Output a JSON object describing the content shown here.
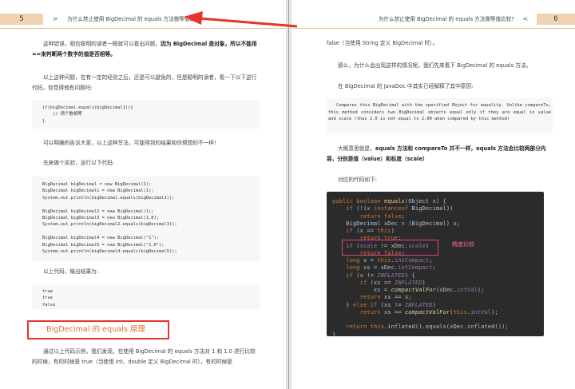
{
  "left_page": {
    "page_number": "5",
    "header_arrow": ">",
    "header_title": "为什么禁止使用 BigDecimal 的 equals 方法做等值比较?",
    "para1_pre": "这种错误，相信聪明的读者一眼就可以看出问题，",
    "para1_bold": "因为 BigDecimal 是对象，所以不能用==来判断两个数字的值是否相等。",
    "para2": "以上这种问题，在有一定的经验之后，还是可以避免的，但是聪明的读者，看一下以下这行代码，你觉得他有问题吗:",
    "code1": "if(bigDecimal.equals(bigDecimal1)){\n    // 两个数相等\n}",
    "para3": "可以明确的告诉大家，以上这种写法，可能得到的结果和你预想的不一样!",
    "para4": "先来做个实验，运行以下代码:",
    "code2": "BigDecimal bigDecimal = new BigDecimal(1);\nBigDecimal bigDecimal1 = new BigDecimal(1);\nSystem.out.println(bigDecimal.equals(bigDecimal1));\n\nBigDecimal bigDecimal2 = new BigDecimal(1);\nBigDecimal bigDecimal3 = new BigDecimal(1.0);\nSystem.out.println(bigDecimal2.equals(bigDecimal3));\n\nBigDecimal bigDecimal4 = new BigDecimal(\"1\");\nBigDecimal bigDecimal5 = new BigDecimal(\"1.0\");\nSystem.out.println(bigDecimal4.equals(bigDecimal5));",
    "para5": "以上代码，输出结果为:",
    "code3": "true\ntrue\nfalse",
    "section_heading": "BigDecimal 的 equals 原理",
    "para6": "通过以上代码示例，我们发现，在使用 BigDecimal 的 equals 方法对 1 和 1.0 进行比较的时候，有的时候是 true（当使用 int、double 定义 BigDecimal 时），有的时候是"
  },
  "right_page": {
    "header_title": "为什么禁止使用 BigDecimal 的 equals 方法做等值比较?",
    "header_arrow": "<",
    "page_number": "6",
    "para1": "false（当使用 String 定义 BigDecimal 时）。",
    "para2": "那么，为什么会出现这样的情况呢，我们先来看下 BigDecimal 的 equals 方法。",
    "para3": "在 BigDecimal 的 JavaDoc 中其实已经解释了其中原因:",
    "javadoc": "Compares this  BigDecimal with the specified Object for equality.  Unlike compareTo, this method considers two BigDecimal objects equal only if they are equal in value and scale (thus 2.0 is not equal to 2.00 when compared by this method)",
    "para4_pre": "大概意思就是，",
    "para4_bold": "equals 方法和 compareTo 并不一样，equals 方法会比较两部分内容，分别是值（value）和标度（scale）",
    "para5": "对应的代码如下:",
    "annotation": "精度比较",
    "code_lines": [
      [
        [
          "kw",
          "public boolean "
        ],
        [
          "fn",
          "equals"
        ],
        [
          "p",
          "(Object x) {"
        ]
      ],
      [
        [
          "p",
          "    "
        ],
        [
          "kw",
          "if "
        ],
        [
          "p",
          "(!(x "
        ],
        [
          "kw",
          "instanceof "
        ],
        [
          "p",
          "BigDecimal))"
        ]
      ],
      [
        [
          "p",
          "        "
        ],
        [
          "kw",
          "return false"
        ],
        [
          "p",
          ";"
        ]
      ],
      [
        [
          "p",
          "    BigDecimal xDec = (BigDecimal) x;"
        ]
      ],
      [
        [
          "p",
          "    "
        ],
        [
          "kw",
          "if "
        ],
        [
          "p",
          "(x == "
        ],
        [
          "kw",
          "this"
        ],
        [
          "p",
          ")"
        ]
      ],
      [
        [
          "p",
          "        "
        ],
        [
          "kw",
          "return true"
        ],
        [
          "p",
          ";"
        ]
      ],
      [
        [
          "p",
          "    "
        ],
        [
          "kw",
          "if "
        ],
        [
          "p",
          "("
        ],
        [
          "fd",
          "scale"
        ],
        [
          "p",
          " != xDec."
        ],
        [
          "fd",
          "scale"
        ],
        [
          "p",
          ")"
        ]
      ],
      [
        [
          "p",
          "        "
        ],
        [
          "kw",
          "return false"
        ],
        [
          "p",
          ";"
        ]
      ],
      [
        [
          "p",
          "    "
        ],
        [
          "kw",
          "long "
        ],
        [
          "p",
          "s = "
        ],
        [
          "kw",
          "this"
        ],
        [
          "p",
          "."
        ],
        [
          "fd",
          "intCompact"
        ],
        [
          "p",
          ";"
        ]
      ],
      [
        [
          "p",
          "    "
        ],
        [
          "kw",
          "long "
        ],
        [
          "p",
          "xs = xDec."
        ],
        [
          "fd",
          "intCompact"
        ],
        [
          "p",
          ";"
        ]
      ],
      [
        [
          "p",
          "    "
        ],
        [
          "kw",
          "if "
        ],
        [
          "p",
          "(s != "
        ],
        [
          "it",
          "INFLATED"
        ],
        [
          "p",
          ") {"
        ]
      ],
      [
        [
          "p",
          "        "
        ],
        [
          "kw",
          "if "
        ],
        [
          "p",
          "(xs == "
        ],
        [
          "it",
          "INFLATED"
        ],
        [
          "p",
          ")"
        ]
      ],
      [
        [
          "p",
          "            xs = "
        ],
        [
          "st",
          "compactValFor"
        ],
        [
          "p",
          "(xDec."
        ],
        [
          "fd",
          "intVal"
        ],
        [
          "p",
          ");"
        ]
      ],
      [
        [
          "p",
          "        "
        ],
        [
          "kw",
          "return "
        ],
        [
          "p",
          "xs == s;"
        ]
      ],
      [
        [
          "p",
          "    } "
        ],
        [
          "kw",
          "else if "
        ],
        [
          "p",
          "(xs != "
        ],
        [
          "it",
          "INFLATED"
        ],
        [
          "p",
          ")"
        ]
      ],
      [
        [
          "p",
          "        "
        ],
        [
          "kw",
          "return "
        ],
        [
          "p",
          "xs == "
        ],
        [
          "st",
          "compactValFor"
        ],
        [
          "p",
          "("
        ],
        [
          "kw",
          "this"
        ],
        [
          "p",
          "."
        ],
        [
          "fd",
          "intVal"
        ],
        [
          "p",
          ");"
        ]
      ],
      [
        [
          "p",
          ""
        ]
      ],
      [
        [
          "p",
          "    "
        ],
        [
          "kw",
          "return this"
        ],
        [
          "p",
          ".inflated().equals(xDec.inflated());"
        ]
      ],
      [
        [
          "p",
          "}"
        ]
      ]
    ]
  },
  "colors": {
    "page_number_bg": "#f2d3b1",
    "header_rule": "#e8c39a",
    "heading_text": "#e0732d",
    "highlight_red": "#e8342b",
    "annotation_pink": "#e63a8f",
    "code_bg": "#2b2b2b"
  }
}
